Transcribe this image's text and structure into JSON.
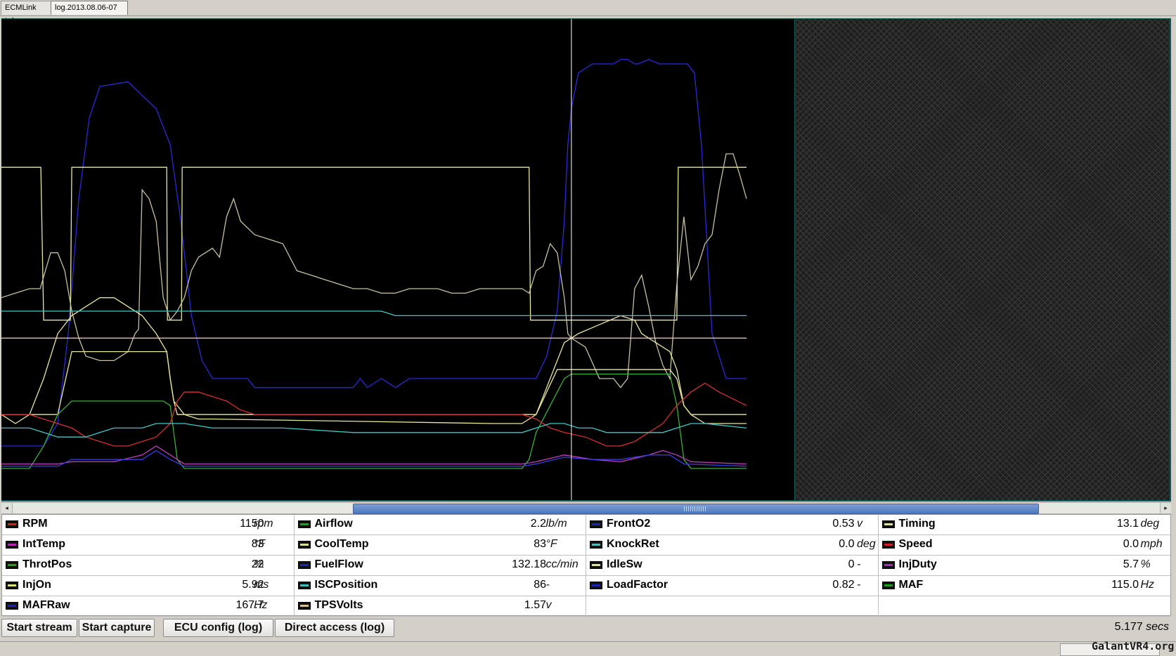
{
  "tabs": [
    {
      "label": "ECMLink Info",
      "active": false
    },
    {
      "label": "log.2013.08.06-07",
      "active": true
    }
  ],
  "chart_data": {
    "type": "line",
    "grid": false,
    "cursor_fraction": 0.765,
    "series": [
      {
        "color": "#2a2ad6",
        "x": [
          0,
          60,
          80,
          95,
          110,
          125,
          140,
          180,
          220,
          240,
          255,
          270,
          285,
          300,
          350,
          360,
          380,
          390,
          400,
          500,
          510,
          520,
          540,
          560,
          580,
          600,
          700,
          760,
          775,
          790,
          800,
          805,
          810,
          820,
          840,
          860,
          870,
          880,
          890,
          900,
          905,
          920,
          935,
          945,
          960,
          975,
          985,
          995,
          1010,
          1030,
          1050,
          1059
        ],
        "y": [
          0.05,
          0.05,
          0.1,
          0.3,
          0.6,
          0.78,
          0.85,
          0.86,
          0.8,
          0.72,
          0.55,
          0.34,
          0.24,
          0.2,
          0.2,
          0.18,
          0.18,
          0.18,
          0.18,
          0.18,
          0.2,
          0.18,
          0.2,
          0.18,
          0.2,
          0.2,
          0.2,
          0.2,
          0.25,
          0.35,
          0.55,
          0.72,
          0.8,
          0.88,
          0.9,
          0.9,
          0.9,
          0.91,
          0.91,
          0.9,
          0.9,
          0.91,
          0.9,
          0.9,
          0.9,
          0.9,
          0.88,
          0.72,
          0.3,
          0.2,
          0.2,
          0.2
        ]
      },
      {
        "color": "#ebe6a0",
        "x": [
          0,
          55,
          56,
          60,
          98,
          100,
          235,
          236,
          240,
          256,
          257,
          745,
          750,
          752,
          800,
          960,
          962,
          1059
        ],
        "y": [
          0.67,
          0.67,
          0.67,
          0.33,
          0.33,
          0.67,
          0.67,
          0.33,
          0.33,
          0.33,
          0.67,
          0.67,
          0.67,
          0.33,
          0.33,
          0.33,
          0.67,
          0.67
        ]
      },
      {
        "color": "#c8c0a0",
        "x": [
          0,
          20,
          40,
          55,
          70,
          80,
          90,
          100,
          110,
          120,
          140,
          160,
          180,
          190,
          195,
          200,
          210,
          220,
          230,
          240,
          250,
          260,
          270,
          280,
          290,
          300,
          310,
          320,
          330,
          340,
          360,
          380,
          400,
          420,
          440,
          460,
          480,
          500,
          520,
          540,
          560,
          580,
          600,
          620,
          640,
          660,
          680,
          700,
          720,
          740,
          750,
          760,
          770,
          780,
          790,
          800,
          805,
          810,
          830,
          850,
          870,
          880,
          890,
          900,
          910,
          920,
          930,
          940,
          950,
          960,
          970,
          980,
          990,
          1000,
          1010,
          1020,
          1030,
          1040,
          1050,
          1059
        ],
        "y": [
          0.38,
          0.39,
          0.4,
          0.4,
          0.48,
          0.48,
          0.44,
          0.35,
          0.29,
          0.25,
          0.24,
          0.24,
          0.26,
          0.3,
          0.31,
          0.62,
          0.6,
          0.55,
          0.38,
          0.33,
          0.35,
          0.38,
          0.44,
          0.47,
          0.48,
          0.49,
          0.47,
          0.56,
          0.6,
          0.55,
          0.52,
          0.51,
          0.5,
          0.44,
          0.43,
          0.42,
          0.41,
          0.4,
          0.4,
          0.39,
          0.39,
          0.4,
          0.4,
          0.4,
          0.39,
          0.39,
          0.4,
          0.4,
          0.4,
          0.4,
          0.39,
          0.44,
          0.45,
          0.5,
          0.48,
          0.38,
          0.3,
          0.29,
          0.27,
          0.2,
          0.2,
          0.18,
          0.2,
          0.4,
          0.43,
          0.36,
          0.28,
          0.23,
          0.2,
          0.41,
          0.56,
          0.42,
          0.45,
          0.5,
          0.52,
          0.62,
          0.7,
          0.7,
          0.65,
          0.6
        ]
      },
      {
        "color": "#ebe6a0",
        "x": [
          0,
          20,
          40,
          60,
          80,
          100,
          120,
          140,
          160,
          180,
          200,
          220,
          235,
          240,
          245,
          250,
          260,
          280,
          300,
          700,
          740,
          760,
          780,
          800,
          820,
          850,
          880,
          900,
          910,
          930,
          950,
          960,
          970,
          980,
          1000,
          1020,
          1059
        ],
        "y": [
          0.12,
          0.1,
          0.12,
          0.2,
          0.3,
          0.34,
          0.36,
          0.38,
          0.38,
          0.36,
          0.34,
          0.3,
          0.26,
          0.2,
          0.15,
          0.14,
          0.12,
          0.11,
          0.11,
          0.1,
          0.1,
          0.12,
          0.2,
          0.28,
          0.3,
          0.32,
          0.34,
          0.33,
          0.3,
          0.28,
          0.26,
          0.22,
          0.14,
          0.12,
          0.1,
          0.1,
          0.1
        ]
      },
      {
        "color": "#ebe6a0",
        "x": [
          0,
          80,
          100,
          200,
          235,
          240,
          245,
          250,
          700,
          740,
          760,
          790,
          800,
          950,
          960,
          970,
          980,
          1059
        ],
        "y": [
          0.12,
          0.12,
          0.26,
          0.26,
          0.26,
          0.2,
          0.15,
          0.12,
          0.12,
          0.12,
          0.12,
          0.22,
          0.22,
          0.22,
          0.2,
          0.14,
          0.12,
          0.12
        ]
      },
      {
        "color": "#39b039",
        "x": [
          0,
          40,
          60,
          80,
          100,
          150,
          200,
          230,
          240,
          245,
          250,
          260,
          740,
          750,
          760,
          780,
          800,
          810,
          900,
          950,
          960,
          970,
          980,
          1059
        ],
        "y": [
          0.0,
          0.0,
          0.05,
          0.12,
          0.15,
          0.15,
          0.15,
          0.15,
          0.14,
          0.08,
          0.02,
          0.0,
          0.0,
          0.02,
          0.08,
          0.14,
          0.2,
          0.21,
          0.21,
          0.21,
          0.14,
          0.02,
          0.0,
          0.0
        ]
      },
      {
        "color": "#d23030",
        "x": [
          0,
          40,
          60,
          80,
          100,
          120,
          140,
          160,
          180,
          200,
          220,
          240,
          250,
          260,
          280,
          300,
          320,
          340,
          360,
          400,
          500,
          600,
          700,
          740,
          760,
          780,
          800,
          830,
          860,
          880,
          900,
          920,
          940,
          960,
          980,
          1000,
          1020,
          1059
        ],
        "y": [
          0.12,
          0.12,
          0.11,
          0.1,
          0.09,
          0.07,
          0.06,
          0.05,
          0.05,
          0.06,
          0.07,
          0.1,
          0.15,
          0.17,
          0.17,
          0.16,
          0.15,
          0.13,
          0.12,
          0.12,
          0.12,
          0.12,
          0.12,
          0.12,
          0.11,
          0.09,
          0.08,
          0.07,
          0.05,
          0.05,
          0.06,
          0.08,
          0.1,
          0.14,
          0.17,
          0.19,
          0.17,
          0.14
        ]
      },
      {
        "color": "#40c8c8",
        "x": [
          0,
          40,
          60,
          80,
          100,
          120,
          140,
          160,
          180,
          200,
          220,
          240,
          260,
          300,
          400,
          500,
          600,
          700,
          740,
          760,
          780,
          800,
          820,
          840,
          860,
          880,
          900,
          920,
          940,
          960,
          980,
          1000,
          1059
        ],
        "y": [
          0.09,
          0.09,
          0.08,
          0.07,
          0.07,
          0.07,
          0.08,
          0.09,
          0.09,
          0.09,
          0.1,
          0.1,
          0.1,
          0.09,
          0.09,
          0.08,
          0.08,
          0.08,
          0.08,
          0.09,
          0.1,
          0.1,
          0.09,
          0.09,
          0.08,
          0.08,
          0.08,
          0.08,
          0.08,
          0.09,
          0.1,
          0.1,
          0.09
        ]
      },
      {
        "color": "#40c8c8",
        "x": [
          0,
          540,
          560,
          1059
        ],
        "y": [
          0.35,
          0.35,
          0.34,
          0.34
        ]
      },
      {
        "color": "#f0d0c8",
        "x": [
          0,
          1059
        ],
        "y": [
          0.29,
          0.29
        ]
      },
      {
        "color": "#c040c0",
        "x": [
          0,
          80,
          100,
          160,
          200,
          220,
          240,
          260,
          740,
          760,
          800,
          840,
          880,
          920,
          940,
          960,
          980,
          1059
        ],
        "y": [
          0.01,
          0.01,
          0.015,
          0.015,
          0.03,
          0.05,
          0.03,
          0.01,
          0.01,
          0.015,
          0.03,
          0.02,
          0.015,
          0.03,
          0.04,
          0.03,
          0.015,
          0.01
        ]
      },
      {
        "color": "#3a3ae0",
        "x": [
          0,
          80,
          100,
          200,
          220,
          240,
          260,
          740,
          760,
          800,
          840,
          880,
          920,
          950,
          970,
          1059
        ],
        "y": [
          0.005,
          0.005,
          0.02,
          0.02,
          0.04,
          0.02,
          0.005,
          0.005,
          0.01,
          0.025,
          0.02,
          0.02,
          0.03,
          0.03,
          0.01,
          0.005
        ]
      }
    ]
  },
  "scrollbar": {
    "left_arrow": "◂",
    "right_arrow": "▸"
  },
  "parameters": [
    {
      "name": "RPM",
      "value": "1150",
      "unit": "rpm",
      "color": "#d02020"
    },
    {
      "name": "Airflow",
      "value": "2.2",
      "unit": "lb/m",
      "color": "#20a020"
    },
    {
      "name": "FrontO2",
      "value": "0.53",
      "unit": "v",
      "color": "#2020c0"
    },
    {
      "name": "Timing",
      "value": "13.1",
      "unit": "deg",
      "color": "#e0e0a0"
    },
    {
      "name": "IntTemp",
      "value": "83",
      "unit": "°F",
      "color": "#c020c0"
    },
    {
      "name": "CoolTemp",
      "value": "83",
      "unit": "°F",
      "color": "#e0e080"
    },
    {
      "name": "KnockRet",
      "value": "0.0",
      "unit": "deg",
      "color": "#40c0c0"
    },
    {
      "name": "Speed",
      "value": "0.0",
      "unit": "mph",
      "color": "#d02020"
    },
    {
      "name": "ThrotPos",
      "value": "22",
      "unit": "%",
      "color": "#20a020"
    },
    {
      "name": "FuelFlow",
      "value": "132.18",
      "unit": "cc/min",
      "color": "#2020c0"
    },
    {
      "name": "IdleSw",
      "value": "0",
      "unit": "-",
      "color": "#e0e0a0"
    },
    {
      "name": "InjDuty",
      "value": "5.7",
      "unit": "%",
      "color": "#c020c0"
    },
    {
      "name": "InjOn",
      "value": "5.92",
      "unit": "ms",
      "color": "#e0e080"
    },
    {
      "name": "ISCPosition",
      "value": "86",
      "unit": "-",
      "color": "#40c0c0"
    },
    {
      "name": "LoadFactor",
      "value": "0.82",
      "unit": "-",
      "color": "#2020c0"
    },
    {
      "name": "MAF",
      "value": "115.0",
      "unit": "Hz",
      "color": "#20a020"
    },
    {
      "name": "MAFRaw",
      "value": "167.7",
      "unit": "Hz",
      "color": "#2020c0"
    },
    {
      "name": "TPSVolts",
      "value": "1.57",
      "unit": "v",
      "color": "#e0c080"
    },
    {
      "name": "",
      "value": "",
      "unit": "",
      "color": ""
    },
    {
      "name": "",
      "value": "",
      "unit": "",
      "color": ""
    }
  ],
  "buttons": {
    "start_stream": "Start stream",
    "start_capture": "Start capture",
    "ecu_config": "ECU config (log)",
    "direct_access": "Direct access (log)"
  },
  "elapsed": {
    "value": "5.177",
    "unit": "secs"
  },
  "watermark": "GalantVR4.org"
}
